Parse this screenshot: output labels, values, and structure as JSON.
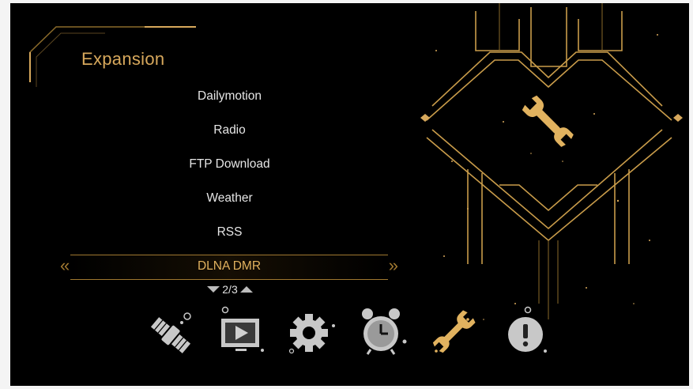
{
  "screen": {
    "title": "Expansion",
    "menu_items": [
      "Dailymotion",
      "Radio",
      "FTP Download",
      "Weather",
      "RSS"
    ],
    "selected_item": "DLNA DMR",
    "pager": "2/3"
  },
  "feature_icon": "wrench-icon",
  "bottom_icons": [
    {
      "name": "satellite-icon",
      "active": false
    },
    {
      "name": "media-player-icon",
      "active": false
    },
    {
      "name": "settings-gear-icon",
      "active": false
    },
    {
      "name": "alarm-clock-icon",
      "active": false
    },
    {
      "name": "wrench-icon",
      "active": true
    },
    {
      "name": "info-icon",
      "active": false
    }
  ],
  "colors": {
    "gold": "#d7a85c",
    "gold_dark": "#a07830",
    "background": "#000000",
    "text": "#e6e6e6",
    "icon_gray": "#c8c8c8"
  }
}
